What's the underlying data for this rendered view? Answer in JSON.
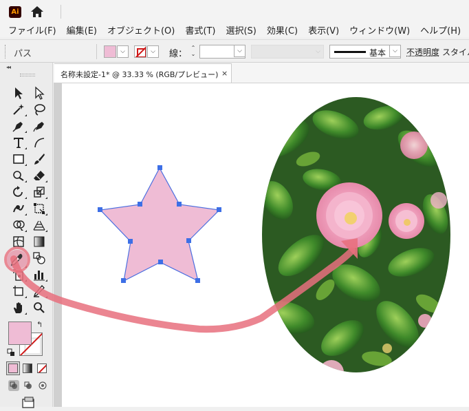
{
  "app": {
    "logo_text": "Ai",
    "home_icon": "home-icon"
  },
  "menu": [
    "ファイル(F)",
    "編集(E)",
    "オブジェクト(O)",
    "書式(T)",
    "選択(S)",
    "効果(C)",
    "表示(V)",
    "ウィンドウ(W)",
    "ヘルプ(H)"
  ],
  "control": {
    "object_type": "パス",
    "fill_color": "#efbcd5",
    "stroke_label": "線：",
    "stroke_weight": "",
    "profile_label": "基本",
    "opacity_label": "不透明度",
    "style_label": "スタイル"
  },
  "panel": {
    "collapse": "◂◂"
  },
  "document": {
    "tab_title": "名称未設定-1* @ 33.33 % (RGB/プレビュー)",
    "close": "×"
  },
  "colors": {
    "fill": "#efbcd5",
    "star_stroke": "#4a6ee0",
    "anchor": "#3d6fe6",
    "arrow": "#e8707e",
    "accent": "#d01818"
  },
  "canvas": {
    "star_fill": "#efbcd5",
    "photo_subject": "pink camellia flowers with green leaves"
  }
}
